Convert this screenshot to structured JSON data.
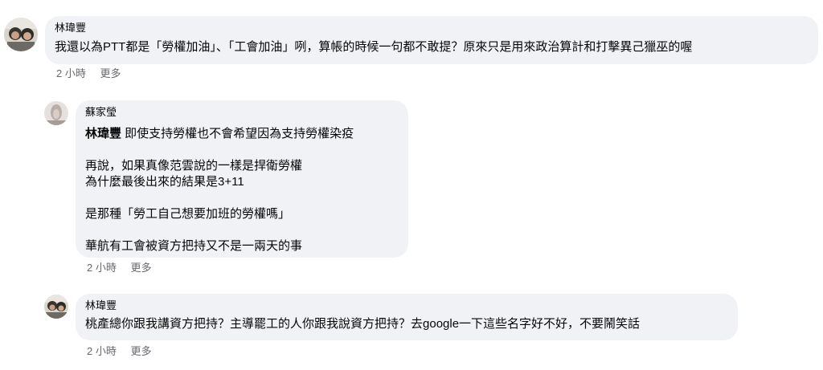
{
  "comments": [
    {
      "author": "林瑋豐",
      "lines": [
        "我還以為PTT都是「勞權加油」、「工會加油」咧，算帳的時候一句都不敢提？原來只是用來政治算計和打擊異己獵巫的喔"
      ],
      "time": "2 小時",
      "more": "更多"
    },
    {
      "author": "蘇家瑩",
      "mention": "林瑋豐",
      "mention_text": " 即使支持勞權也不會希望因為支持勞權染疫",
      "lines": [
        "再說，如果真像范雲說的一樣是捍衛勞權",
        "為什麼最後出來的結果是3+11",
        "是那種「勞工自己想要加班的勞權嗎」",
        "華航有工會被資方把持又不是一兩天的事"
      ],
      "time": "2 小時",
      "more": "更多"
    },
    {
      "author": "林瑋豐",
      "lines": [
        "桃產總你跟我講資方把持？主導罷工的人你跟我說資方把持？去google一下這些名字好不好，不要鬧笑話"
      ],
      "time": "2 小時",
      "more": "更多"
    }
  ],
  "colors": {
    "bubble_bg": "#f0f2f5",
    "meta_text": "#65676b",
    "text": "#050505"
  }
}
